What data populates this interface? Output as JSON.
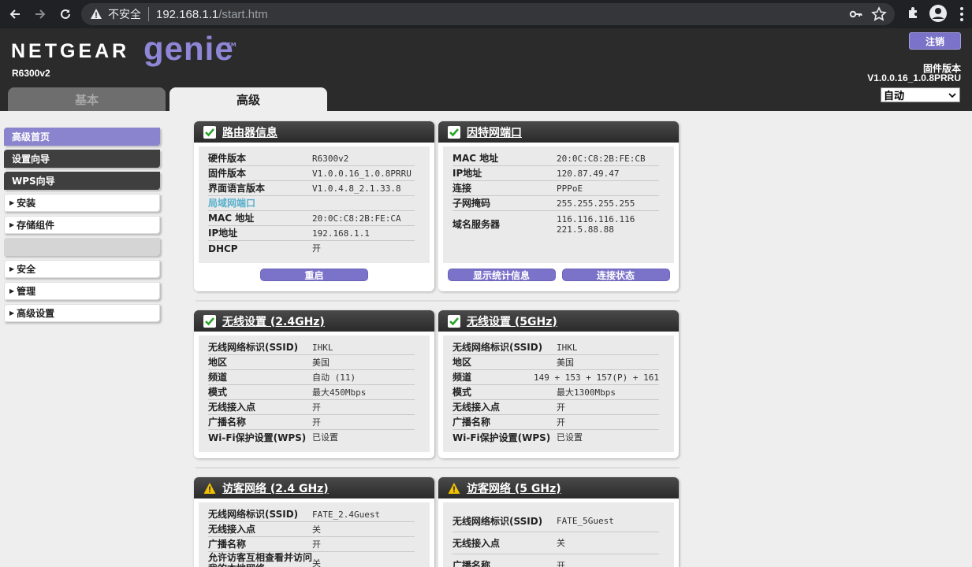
{
  "browser": {
    "security_label": "不安全",
    "url_host": "192.168.1.1",
    "url_path": "/start.htm"
  },
  "header": {
    "brand": "NETGEAR",
    "product": "genie",
    "tm": "TM",
    "model": "R6300v2",
    "tab_basic": "基本",
    "tab_advanced": "高级",
    "logout": "注销",
    "fw_label": "固件版本",
    "fw_version": "V1.0.0.16_1.0.8PRRU",
    "language": "自动"
  },
  "sidebar": {
    "items": [
      {
        "label": "高级首页"
      },
      {
        "label": "设置向导"
      },
      {
        "label": "WPS向导"
      },
      {
        "label": "安装"
      },
      {
        "label": "存储组件"
      },
      {
        "label": ""
      },
      {
        "label": "安全"
      },
      {
        "label": "管理"
      },
      {
        "label": "高级设置"
      }
    ]
  },
  "router_info": {
    "title": "路由器信息",
    "rows": [
      {
        "k": "硬件版本",
        "v": "R6300v2"
      },
      {
        "k": "固件版本",
        "v": "V1.0.0.16_1.0.8PRRU"
      },
      {
        "k": "界面语言版本",
        "v": "V1.0.4.8_2.1.33.8"
      },
      {
        "k": "局域网端口",
        "v": ""
      },
      {
        "k": "MAC 地址",
        "v": "20:0C:C8:2B:FE:CA"
      },
      {
        "k": "IP地址",
        "v": "192.168.1.1"
      },
      {
        "k": "DHCP",
        "v": "开"
      }
    ],
    "button": "重启"
  },
  "internet_port": {
    "title": "因特网端口",
    "rows": [
      {
        "k": "MAC 地址",
        "v": "20:0C:C8:2B:FE:CB"
      },
      {
        "k": "IP地址",
        "v": "120.87.49.47"
      },
      {
        "k": "连接",
        "v": "PPPoE"
      },
      {
        "k": "子网掩码",
        "v": "255.255.255.255"
      },
      {
        "k": "域名服务器",
        "v": "116.116.116.116",
        "v2": "221.5.88.88"
      }
    ],
    "button1": "显示统计信息",
    "button2": "连接状态"
  },
  "wireless_24": {
    "title": "无线设置 (2.4GHz)",
    "rows": [
      {
        "k": "无线网络标识(SSID)",
        "v": "IHKL"
      },
      {
        "k": "地区",
        "v": "美国"
      },
      {
        "k": "频道",
        "v": "自动 (11)"
      },
      {
        "k": "模式",
        "v": "最大450Mbps"
      },
      {
        "k": "无线接入点",
        "v": "开"
      },
      {
        "k": "广播名称",
        "v": "开"
      },
      {
        "k": "Wi-Fi保护设置(WPS)",
        "v": "已设置"
      }
    ]
  },
  "wireless_5": {
    "title": "无线设置 (5GHz)",
    "rows": [
      {
        "k": "无线网络标识(SSID)",
        "v": "IHKL"
      },
      {
        "k": "地区",
        "v": "美国"
      },
      {
        "k": "频道",
        "v": "149 + 153 + 157(P) + 161"
      },
      {
        "k": "模式",
        "v": "最大1300Mbps"
      },
      {
        "k": "无线接入点",
        "v": "开"
      },
      {
        "k": "广播名称",
        "v": "开"
      },
      {
        "k": "Wi-Fi保护设置(WPS)",
        "v": "已设置"
      }
    ]
  },
  "guest_24": {
    "title": "访客网络 (2.4 GHz)",
    "rows": [
      {
        "k": "无线网络标识(SSID)",
        "v": "FATE_2.4Guest"
      },
      {
        "k": "无线接入点",
        "v": "关"
      },
      {
        "k": "广播名称",
        "v": "开"
      },
      {
        "k": "允许访客互相查看并访问我的本地网络",
        "v": "关"
      }
    ]
  },
  "guest_5": {
    "title": "访客网络 (5 GHz)",
    "rows": [
      {
        "k": "无线网络标识(SSID)",
        "v": "FATE_5Guest"
      },
      {
        "k": "无线接入点",
        "v": "关"
      },
      {
        "k": "广播名称",
        "v": "开"
      }
    ]
  },
  "colors": {
    "accent": "#7b73c9",
    "header_bg": "#2b2b2b",
    "ok_green": "#2aa52a",
    "warn_yellow": "#f2c200"
  }
}
